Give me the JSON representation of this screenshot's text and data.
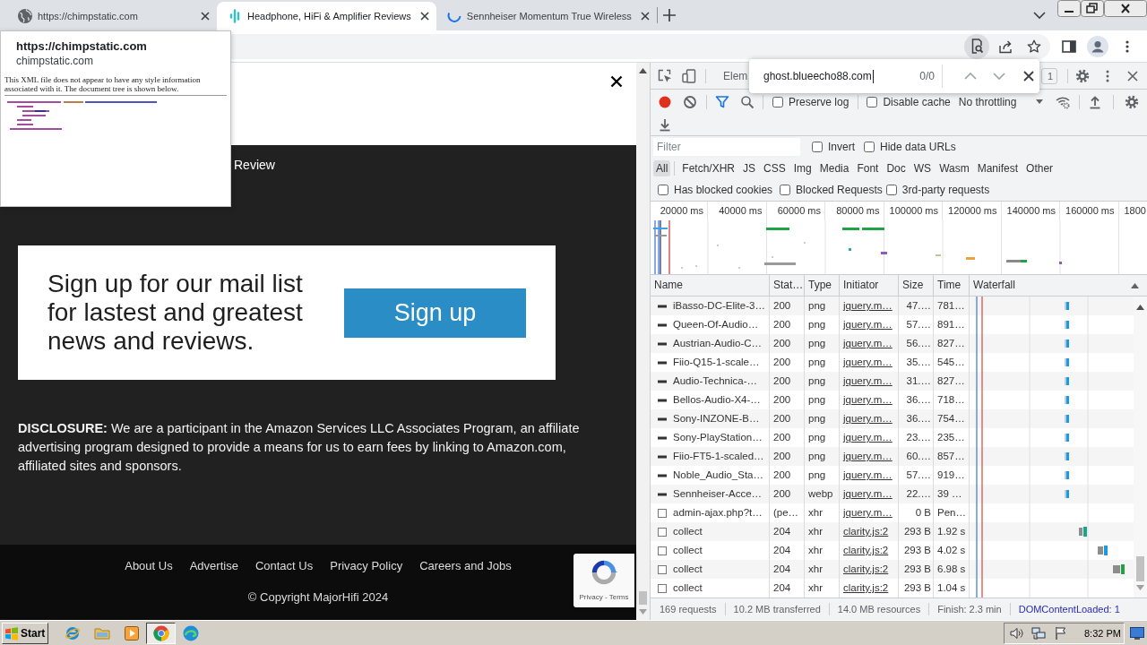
{
  "browser": {
    "tabs": [
      {
        "kind": "globe",
        "title": "https://chimpstatic.com",
        "selected": false
      },
      {
        "kind": "site",
        "title": "Headphone, HiFi & Amplifier Reviews",
        "selected": true
      },
      {
        "kind": "loading",
        "title": "Sennheiser Momentum True Wireless",
        "selected": false
      }
    ],
    "find_active": true
  },
  "hover_card": {
    "title": "https://chimpstatic.com",
    "domain": "chimpstatic.com",
    "preview_note": "This XML file does not appear to have any style information associated with it. The document tree is shown below."
  },
  "page": {
    "hero_text": "Review",
    "signup": {
      "text": "Sign up for our mail list for lastest and greatest news and reviews.",
      "button": "Sign up"
    },
    "disclosure": "**DISCLOSURE:** We are a participant in the Amazon Services LLC Associates Program, an affiliate advertising program designed to provide a means for us to earn fees by linking to Amazon.com, affiliated sites and sponsors.",
    "footer_links": [
      "About Us",
      "Advertise",
      "Contact Us",
      "Privacy Policy",
      "Careers and Jobs"
    ],
    "copyright": "© Copyright MajorHifi 2024",
    "recaptcha": "Privacy - Terms"
  },
  "devtools": {
    "panel_tab": "Elem",
    "issues": "1",
    "find": {
      "value": "ghost.blueecho88.com",
      "count": "0/0"
    },
    "recording": true,
    "preserve_log": {
      "label": "Preserve log",
      "checked": false
    },
    "disable_cache": {
      "label": "Disable cache",
      "checked": false
    },
    "throttling": "No throttling",
    "filter": {
      "placeholder": "Filter"
    },
    "filter_options": [
      {
        "label": "Invert",
        "checked": false
      },
      {
        "label": "Hide data URLs",
        "checked": false
      }
    ],
    "type_filters": [
      {
        "label": "All",
        "selected": true
      },
      {
        "label": "Fetch/XHR",
        "selected": false
      },
      {
        "label": "JS",
        "selected": false
      },
      {
        "label": "CSS",
        "selected": false
      },
      {
        "label": "Img",
        "selected": false
      },
      {
        "label": "Media",
        "selected": false
      },
      {
        "label": "Font",
        "selected": false
      },
      {
        "label": "Doc",
        "selected": false
      },
      {
        "label": "WS",
        "selected": false
      },
      {
        "label": "Wasm",
        "selected": false
      },
      {
        "label": "Manifest",
        "selected": false
      },
      {
        "label": "Other",
        "selected": false
      }
    ],
    "request_options": [
      {
        "label": "Has blocked cookies",
        "checked": false
      },
      {
        "label": "Blocked Requests",
        "checked": false
      },
      {
        "label": "3rd-party requests",
        "checked": false
      }
    ],
    "overview_ticks": [
      "20000 ms",
      "40000 ms",
      "60000 ms",
      "80000 ms",
      "100000 ms",
      "120000 ms",
      "140000 ms",
      "160000 ms",
      "1800"
    ],
    "columns": [
      "Name",
      "Stat…",
      "Type",
      "Initiator",
      "Size",
      "Time",
      "Waterfall"
    ],
    "rows": [
      {
        "kind": "image",
        "name": "iBasso-DC-Elite-3…",
        "status": "200",
        "type": "png",
        "initiator": "jquery.m…",
        "size": "47.…",
        "time": "781…"
      },
      {
        "kind": "image",
        "name": "Queen-Of-Audio…",
        "status": "200",
        "type": "png",
        "initiator": "jquery.m…",
        "size": "57.…",
        "time": "891…"
      },
      {
        "kind": "image",
        "name": "Austrian-Audio-C…",
        "status": "200",
        "type": "png",
        "initiator": "jquery.m…",
        "size": "56.…",
        "time": "827…"
      },
      {
        "kind": "image",
        "name": "Fiio-Q15-1-scale…",
        "status": "200",
        "type": "png",
        "initiator": "jquery.m…",
        "size": "35.…",
        "time": "545…"
      },
      {
        "kind": "image",
        "name": "Audio-Technica-…",
        "status": "200",
        "type": "png",
        "initiator": "jquery.m…",
        "size": "31.…",
        "time": "827…"
      },
      {
        "kind": "image",
        "name": "Bellos-Audio-X4-…",
        "status": "200",
        "type": "png",
        "initiator": "jquery.m…",
        "size": "36.…",
        "time": "718…"
      },
      {
        "kind": "image",
        "name": "Sony-INZONE-B…",
        "status": "200",
        "type": "png",
        "initiator": "jquery.m…",
        "size": "36.…",
        "time": "754…"
      },
      {
        "kind": "image",
        "name": "Sony-PlayStation…",
        "status": "200",
        "type": "png",
        "initiator": "jquery.m…",
        "size": "23.…",
        "time": "235…"
      },
      {
        "kind": "image",
        "name": "Fiio-FT5-1-scaled…",
        "status": "200",
        "type": "png",
        "initiator": "jquery.m…",
        "size": "60.…",
        "time": "857…"
      },
      {
        "kind": "image",
        "name": "Noble_Audio_Sta…",
        "status": "200",
        "type": "png",
        "initiator": "jquery.m…",
        "size": "57.…",
        "time": "919…"
      },
      {
        "kind": "image",
        "name": "Sennheiser-Acce…",
        "status": "200",
        "type": "webp",
        "initiator": "jquery.m…",
        "size": "22.…",
        "time": "39 …"
      },
      {
        "kind": "xhr",
        "name": "admin-ajax.php?t…",
        "status": "(pe…",
        "type": "xhr",
        "initiator": "jquery.m…",
        "size": "0 B",
        "time": "Pen…"
      },
      {
        "kind": "xhr",
        "name": "collect",
        "status": "204",
        "type": "xhr",
        "initiator": "clarity.js:2",
        "size": "293 B",
        "time": "1.92 s"
      },
      {
        "kind": "xhr",
        "name": "collect",
        "status": "204",
        "type": "xhr",
        "initiator": "clarity.js:2",
        "size": "293 B",
        "time": "4.02 s"
      },
      {
        "kind": "xhr",
        "name": "collect",
        "status": "204",
        "type": "xhr",
        "initiator": "clarity.js:2",
        "size": "293 B",
        "time": "6.98 s"
      },
      {
        "kind": "xhr",
        "name": "collect",
        "status": "204",
        "type": "xhr",
        "initiator": "clarity.js:2",
        "size": "293 B",
        "time": "1.04 s"
      }
    ],
    "summary": [
      "169 requests",
      "10.2 MB transferred",
      "14.0 MB resources",
      "Finish: 2.3 min"
    ],
    "dom_content_loaded": "DOMContentLoaded: 1"
  },
  "taskbar": {
    "start": "Start",
    "apps": [
      {
        "kind": "ie",
        "selected": false
      },
      {
        "kind": "folder",
        "selected": false
      },
      {
        "kind": "player",
        "selected": false
      },
      {
        "kind": "chrome",
        "selected": true
      },
      {
        "kind": "edge",
        "selected": false
      }
    ],
    "clock": "8:32 PM"
  }
}
